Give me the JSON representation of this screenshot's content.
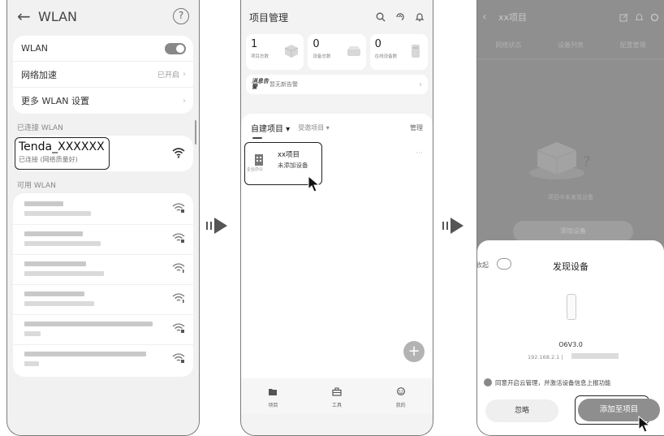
{
  "phone1": {
    "title": "WLAN",
    "wlan_label": "WLAN",
    "accel_label": "网络加速",
    "accel_value": "已开启",
    "more_label": "更多 WLAN 设置",
    "connected_section": "已连接 WLAN",
    "connected_ssid": "Tenda_XXXXXX",
    "connected_status": "已连接 (网络质量好)",
    "available_section": "可用 WLAN"
  },
  "phone2": {
    "title": "项目管理",
    "stats": [
      {
        "num": "1",
        "label": "项目总数"
      },
      {
        "num": "0",
        "label": "设备总数"
      },
      {
        "num": "0",
        "label": "在线设备数"
      }
    ],
    "alert_tag": "消息告警",
    "alert_text": "暂无新告警",
    "tab_own": "自建项目 ▾",
    "tab_invited": "受邀项目 ▾",
    "tab_manage": "管理",
    "project_name": "xx项目",
    "project_status": "未添加设备",
    "project_type": "企业办公",
    "project_more": "···",
    "fab": "+",
    "tabbar": [
      {
        "label": "项目",
        "icon": "project-icon"
      },
      {
        "label": "工具",
        "icon": "toolbox-icon"
      },
      {
        "label": "我的",
        "icon": "profile-icon"
      }
    ]
  },
  "phone3": {
    "title": "xx项目",
    "tabs": [
      "网络状态",
      "设备列表",
      "配置管理"
    ],
    "empty_text": "项目中未发现设备",
    "add_device": "添加设备",
    "sheet_collapse": "收起",
    "sheet_title": "发现设备",
    "device_model": "O6V3.0",
    "device_ip": "192.168.2.1 |",
    "agree_text": "同意开启云管理，并激活设备信息上报功能",
    "ignore_btn": "忽略",
    "add_to_project_btn": "添加至项目"
  }
}
